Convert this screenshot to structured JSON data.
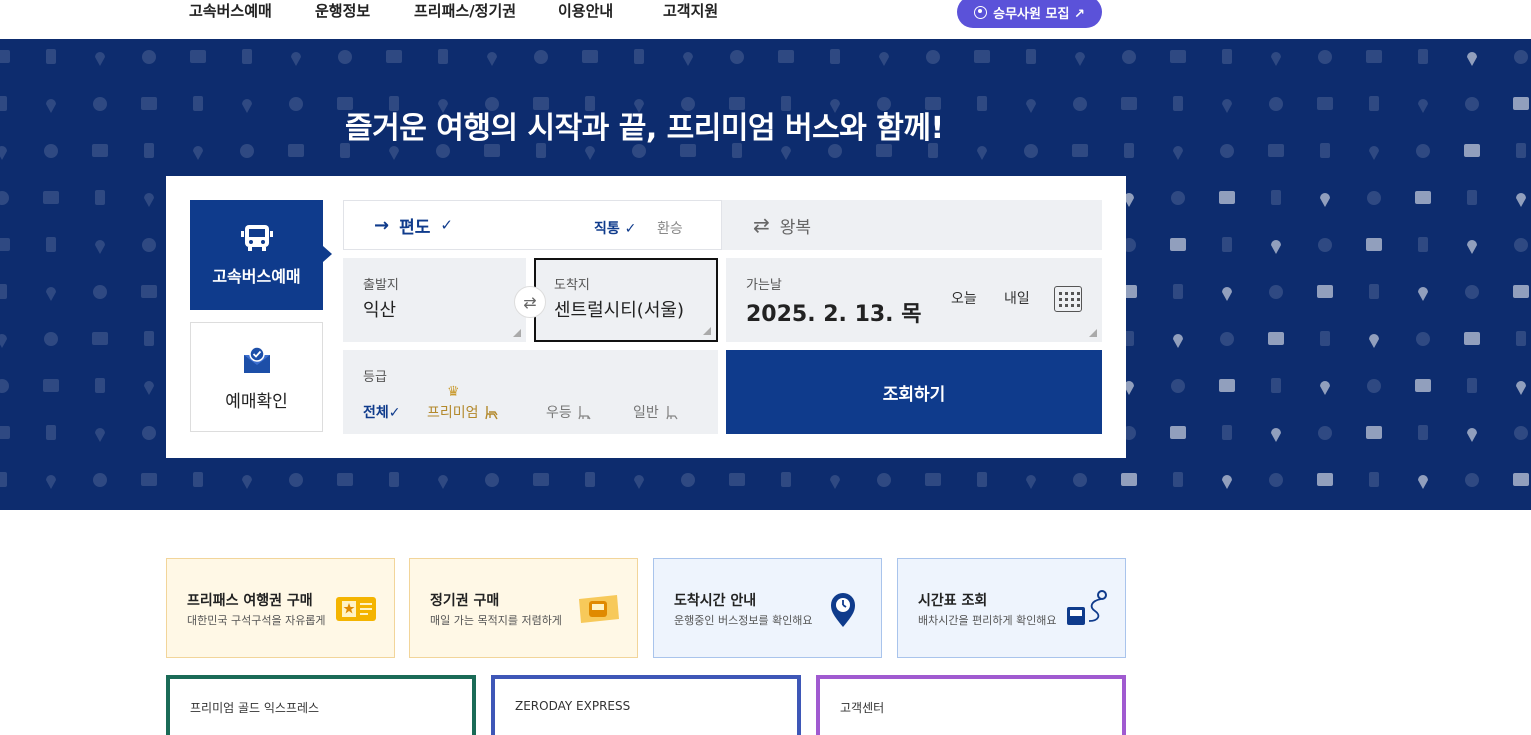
{
  "nav": {
    "items": [
      "고속버스예매",
      "운행정보",
      "프리패스/정기권",
      "이용안내",
      "고객지원"
    ],
    "recruit_label": "승무사원 모집 ↗"
  },
  "hero": {
    "title": "즐거운 여행의 시작과 끝, 프리미엄 버스와 함께!"
  },
  "side_tabs": {
    "booking": "고속버스예매",
    "check": "예매확인"
  },
  "trip": {
    "oneway_arrow": "→",
    "oneway": "편도",
    "oneway_check": "✓",
    "direct": "직통 ✓",
    "transfer": "환승",
    "round_icon": "⇄",
    "round": "왕복"
  },
  "departure": {
    "label": "출발지",
    "value": "익산"
  },
  "swap_icon": "⇄",
  "arrival": {
    "label": "도착지",
    "value": "센트럴시티(서울)"
  },
  "date": {
    "label": "가는날",
    "value": "2025. 2. 13. 목",
    "today": "오늘",
    "tomorrow": "내일"
  },
  "grade": {
    "label": "등급",
    "options": [
      "전체✓",
      "프리미엄",
      "우등",
      "일반"
    ],
    "crown_icon": "♛"
  },
  "search_button": "조회하기",
  "quick_links": [
    {
      "title": "프리패스 여행권 구매",
      "desc": "대한민국 구석구석을 자유롭게"
    },
    {
      "title": "정기권 구매",
      "desc": "매일 가는 목적지를 저렴하게"
    },
    {
      "title": "도착시간 안내",
      "desc": "운행중인 버스정보를 확인해요"
    },
    {
      "title": "시간표 조회",
      "desc": "배차시간을 편리하게 확인해요"
    }
  ],
  "promos": [
    "프리미엄 골드 익스프레스",
    "ZERODAY EXPRESS",
    "고객센터"
  ],
  "colors": {
    "hero_bg": "#0d2c6e",
    "primary": "#0f3b8c",
    "recruit": "#5b52d9",
    "premium_gold": "#b3892c"
  }
}
